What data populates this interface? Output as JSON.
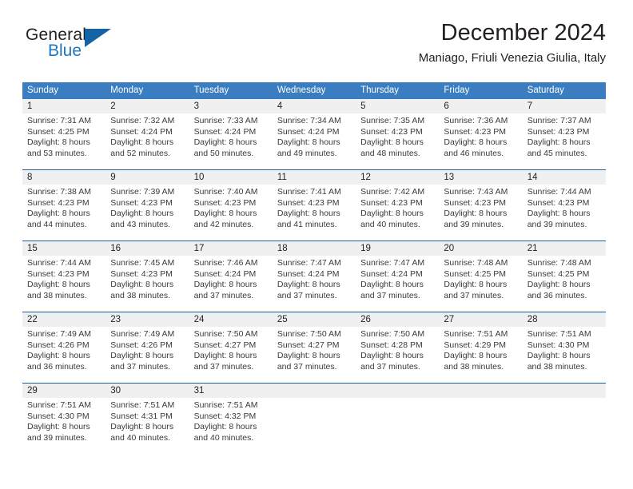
{
  "logo": {
    "word_top": "General",
    "word_bottom": "Blue",
    "triangle_color": "#1464a5",
    "blue_color": "#1c77c3"
  },
  "header": {
    "title": "December 2024",
    "subtitle": "Maniago, Friuli Venezia Giulia, Italy"
  },
  "theme": {
    "header_bg": "#3a7dc0",
    "row_divider": "#1f5f9e",
    "daynum_bg": "#f0f0f0"
  },
  "calendar": {
    "weekday_headers": [
      "Sunday",
      "Monday",
      "Tuesday",
      "Wednesday",
      "Thursday",
      "Friday",
      "Saturday"
    ],
    "weeks": [
      [
        {
          "day": "1",
          "sunrise": "Sunrise: 7:31 AM",
          "sunset": "Sunset: 4:25 PM",
          "daylight1": "Daylight: 8 hours",
          "daylight2": "and 53 minutes."
        },
        {
          "day": "2",
          "sunrise": "Sunrise: 7:32 AM",
          "sunset": "Sunset: 4:24 PM",
          "daylight1": "Daylight: 8 hours",
          "daylight2": "and 52 minutes."
        },
        {
          "day": "3",
          "sunrise": "Sunrise: 7:33 AM",
          "sunset": "Sunset: 4:24 PM",
          "daylight1": "Daylight: 8 hours",
          "daylight2": "and 50 minutes."
        },
        {
          "day": "4",
          "sunrise": "Sunrise: 7:34 AM",
          "sunset": "Sunset: 4:24 PM",
          "daylight1": "Daylight: 8 hours",
          "daylight2": "and 49 minutes."
        },
        {
          "day": "5",
          "sunrise": "Sunrise: 7:35 AM",
          "sunset": "Sunset: 4:23 PM",
          "daylight1": "Daylight: 8 hours",
          "daylight2": "and 48 minutes."
        },
        {
          "day": "6",
          "sunrise": "Sunrise: 7:36 AM",
          "sunset": "Sunset: 4:23 PM",
          "daylight1": "Daylight: 8 hours",
          "daylight2": "and 46 minutes."
        },
        {
          "day": "7",
          "sunrise": "Sunrise: 7:37 AM",
          "sunset": "Sunset: 4:23 PM",
          "daylight1": "Daylight: 8 hours",
          "daylight2": "and 45 minutes."
        }
      ],
      [
        {
          "day": "8",
          "sunrise": "Sunrise: 7:38 AM",
          "sunset": "Sunset: 4:23 PM",
          "daylight1": "Daylight: 8 hours",
          "daylight2": "and 44 minutes."
        },
        {
          "day": "9",
          "sunrise": "Sunrise: 7:39 AM",
          "sunset": "Sunset: 4:23 PM",
          "daylight1": "Daylight: 8 hours",
          "daylight2": "and 43 minutes."
        },
        {
          "day": "10",
          "sunrise": "Sunrise: 7:40 AM",
          "sunset": "Sunset: 4:23 PM",
          "daylight1": "Daylight: 8 hours",
          "daylight2": "and 42 minutes."
        },
        {
          "day": "11",
          "sunrise": "Sunrise: 7:41 AM",
          "sunset": "Sunset: 4:23 PM",
          "daylight1": "Daylight: 8 hours",
          "daylight2": "and 41 minutes."
        },
        {
          "day": "12",
          "sunrise": "Sunrise: 7:42 AM",
          "sunset": "Sunset: 4:23 PM",
          "daylight1": "Daylight: 8 hours",
          "daylight2": "and 40 minutes."
        },
        {
          "day": "13",
          "sunrise": "Sunrise: 7:43 AM",
          "sunset": "Sunset: 4:23 PM",
          "daylight1": "Daylight: 8 hours",
          "daylight2": "and 39 minutes."
        },
        {
          "day": "14",
          "sunrise": "Sunrise: 7:44 AM",
          "sunset": "Sunset: 4:23 PM",
          "daylight1": "Daylight: 8 hours",
          "daylight2": "and 39 minutes."
        }
      ],
      [
        {
          "day": "15",
          "sunrise": "Sunrise: 7:44 AM",
          "sunset": "Sunset: 4:23 PM",
          "daylight1": "Daylight: 8 hours",
          "daylight2": "and 38 minutes."
        },
        {
          "day": "16",
          "sunrise": "Sunrise: 7:45 AM",
          "sunset": "Sunset: 4:23 PM",
          "daylight1": "Daylight: 8 hours",
          "daylight2": "and 38 minutes."
        },
        {
          "day": "17",
          "sunrise": "Sunrise: 7:46 AM",
          "sunset": "Sunset: 4:24 PM",
          "daylight1": "Daylight: 8 hours",
          "daylight2": "and 37 minutes."
        },
        {
          "day": "18",
          "sunrise": "Sunrise: 7:47 AM",
          "sunset": "Sunset: 4:24 PM",
          "daylight1": "Daylight: 8 hours",
          "daylight2": "and 37 minutes."
        },
        {
          "day": "19",
          "sunrise": "Sunrise: 7:47 AM",
          "sunset": "Sunset: 4:24 PM",
          "daylight1": "Daylight: 8 hours",
          "daylight2": "and 37 minutes."
        },
        {
          "day": "20",
          "sunrise": "Sunrise: 7:48 AM",
          "sunset": "Sunset: 4:25 PM",
          "daylight1": "Daylight: 8 hours",
          "daylight2": "and 37 minutes."
        },
        {
          "day": "21",
          "sunrise": "Sunrise: 7:48 AM",
          "sunset": "Sunset: 4:25 PM",
          "daylight1": "Daylight: 8 hours",
          "daylight2": "and 36 minutes."
        }
      ],
      [
        {
          "day": "22",
          "sunrise": "Sunrise: 7:49 AM",
          "sunset": "Sunset: 4:26 PM",
          "daylight1": "Daylight: 8 hours",
          "daylight2": "and 36 minutes."
        },
        {
          "day": "23",
          "sunrise": "Sunrise: 7:49 AM",
          "sunset": "Sunset: 4:26 PM",
          "daylight1": "Daylight: 8 hours",
          "daylight2": "and 37 minutes."
        },
        {
          "day": "24",
          "sunrise": "Sunrise: 7:50 AM",
          "sunset": "Sunset: 4:27 PM",
          "daylight1": "Daylight: 8 hours",
          "daylight2": "and 37 minutes."
        },
        {
          "day": "25",
          "sunrise": "Sunrise: 7:50 AM",
          "sunset": "Sunset: 4:27 PM",
          "daylight1": "Daylight: 8 hours",
          "daylight2": "and 37 minutes."
        },
        {
          "day": "26",
          "sunrise": "Sunrise: 7:50 AM",
          "sunset": "Sunset: 4:28 PM",
          "daylight1": "Daylight: 8 hours",
          "daylight2": "and 37 minutes."
        },
        {
          "day": "27",
          "sunrise": "Sunrise: 7:51 AM",
          "sunset": "Sunset: 4:29 PM",
          "daylight1": "Daylight: 8 hours",
          "daylight2": "and 38 minutes."
        },
        {
          "day": "28",
          "sunrise": "Sunrise: 7:51 AM",
          "sunset": "Sunset: 4:30 PM",
          "daylight1": "Daylight: 8 hours",
          "daylight2": "and 38 minutes."
        }
      ],
      [
        {
          "day": "29",
          "sunrise": "Sunrise: 7:51 AM",
          "sunset": "Sunset: 4:30 PM",
          "daylight1": "Daylight: 8 hours",
          "daylight2": "and 39 minutes."
        },
        {
          "day": "30",
          "sunrise": "Sunrise: 7:51 AM",
          "sunset": "Sunset: 4:31 PM",
          "daylight1": "Daylight: 8 hours",
          "daylight2": "and 40 minutes."
        },
        {
          "day": "31",
          "sunrise": "Sunrise: 7:51 AM",
          "sunset": "Sunset: 4:32 PM",
          "daylight1": "Daylight: 8 hours",
          "daylight2": "and 40 minutes."
        },
        {
          "day": "",
          "sunrise": "",
          "sunset": "",
          "daylight1": "",
          "daylight2": ""
        },
        {
          "day": "",
          "sunrise": "",
          "sunset": "",
          "daylight1": "",
          "daylight2": ""
        },
        {
          "day": "",
          "sunrise": "",
          "sunset": "",
          "daylight1": "",
          "daylight2": ""
        },
        {
          "day": "",
          "sunrise": "",
          "sunset": "",
          "daylight1": "",
          "daylight2": ""
        }
      ]
    ]
  }
}
